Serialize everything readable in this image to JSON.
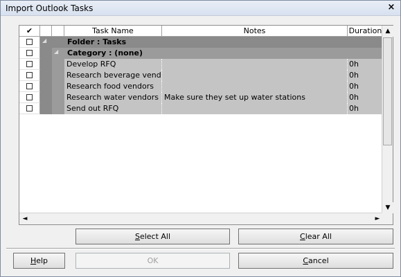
{
  "window": {
    "title": "Import Outlook Tasks",
    "close_label": "×"
  },
  "columns": {
    "check": "✔",
    "task_name": "Task Name",
    "notes": "Notes",
    "duration": "Duration"
  },
  "rows": [
    {
      "type": "folder",
      "label": "Folder : Tasks",
      "notes": "",
      "duration": ""
    },
    {
      "type": "category",
      "label": "Category : (none)",
      "notes": "",
      "duration": ""
    },
    {
      "type": "task",
      "label": "Develop RFQ",
      "notes": "",
      "duration": "0h"
    },
    {
      "type": "task",
      "label": "Research beverage vendors",
      "notes": "",
      "duration": "0h"
    },
    {
      "type": "task",
      "label": "Research food vendors",
      "notes": "",
      "duration": "0h"
    },
    {
      "type": "task",
      "label": "Research water vendors",
      "notes": "Make sure they set up water stations",
      "duration": "0h"
    },
    {
      "type": "task",
      "label": "Send out RFQ",
      "notes": "",
      "duration": "0h"
    }
  ],
  "buttons": {
    "select_all": {
      "mnemonic": "S",
      "rest": "elect All"
    },
    "clear_all": {
      "mnemonic": "C",
      "rest": "lear All"
    },
    "help": {
      "mnemonic": "H",
      "rest": "elp"
    },
    "ok": "OK",
    "cancel": {
      "mnemonic": "C",
      "rest": "ancel"
    }
  },
  "scrollbar": {
    "up": "▲",
    "down": "▼",
    "left": "◄",
    "right": "►"
  }
}
